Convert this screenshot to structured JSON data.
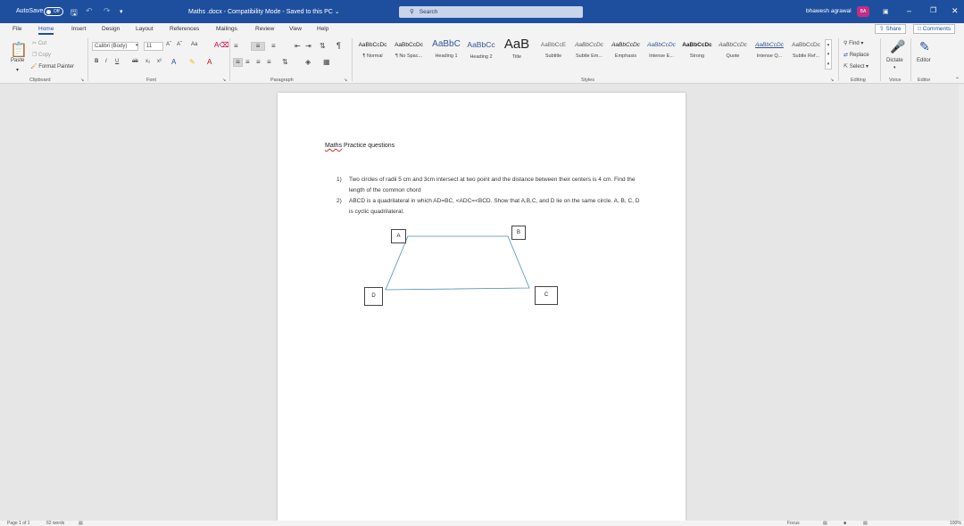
{
  "titlebar": {
    "autosave_label": "AutoSave",
    "autosave_state": "Off",
    "doc_title": "Maths .docx  -  Compatibility Mode  -  Saved to this PC  ⌄",
    "search_placeholder": "Search",
    "user_name": "bhawesh agrawal",
    "user_initials": "BA"
  },
  "menu": {
    "tabs": [
      "File",
      "Home",
      "Insert",
      "Design",
      "Layout",
      "References",
      "Mailings",
      "Review",
      "View",
      "Help"
    ],
    "share": "Share",
    "comments": "Comments"
  },
  "ribbon": {
    "clipboard": {
      "cut": "Cut",
      "copy": "Copy",
      "paste": "Paste",
      "format_painter": "Format Painter",
      "label": "Clipboard"
    },
    "font": {
      "name": "Calibri (Body)",
      "size": "11",
      "label": "Font",
      "case": "Aa"
    },
    "paragraph": {
      "label": "Paragraph"
    },
    "styles": {
      "label": "Styles",
      "items": [
        {
          "sample": "AaBbCcDc",
          "name": "¶ Normal"
        },
        {
          "sample": "AaBbCcDc",
          "name": "¶ No Spac..."
        },
        {
          "sample": "AaBbC",
          "name": "Heading 1"
        },
        {
          "sample": "AaBbCc",
          "name": "Heading 2"
        },
        {
          "sample": "AaB",
          "name": "Title"
        },
        {
          "sample": "AaBbCcE",
          "name": "Subtitle"
        },
        {
          "sample": "AaBbCcDc",
          "name": "Subtle Em..."
        },
        {
          "sample": "AaBbCcDc",
          "name": "Emphasis"
        },
        {
          "sample": "AaBbCcDc",
          "name": "Intense E..."
        },
        {
          "sample": "AaBbCcDc",
          "name": "Strong"
        },
        {
          "sample": "AaBbCcDc",
          "name": "Quote"
        },
        {
          "sample": "AaBbCcDc",
          "name": "Intense Q..."
        },
        {
          "sample": "AaBbCcDc",
          "name": "Subtle Ref..."
        }
      ]
    },
    "editing": {
      "find": "Find",
      "replace": "Replace",
      "select": "Select",
      "label": "Editing"
    },
    "voice": {
      "dictate": "Dictate",
      "label": "Voice"
    },
    "editor": {
      "editor": "Editor",
      "label": "Editor"
    }
  },
  "document": {
    "heading_underlined": "Maths",
    "heading_rest": " Practice questions",
    "questions": [
      {
        "num": "1)",
        "text": "Two circles of radii 5 cm and 3cm intersect at two point and the distance between their centers is 4 cm. Find the length of the common chord"
      },
      {
        "num": "2)",
        "text": "ABCD is a quadrilateral in which AD=BC, <ADC=<BCD. Show that A,B,C, and D lie on the same circle. A, B, C, D is cyclic quadrilateral."
      }
    ],
    "figure_labels": {
      "a": "A",
      "b": "B",
      "c": "C",
      "d": "D"
    }
  },
  "status": {
    "page": "Page 1 of 1",
    "words": "62 words",
    "focus": "Focus",
    "zoom": "100%"
  },
  "colors": {
    "word_blue": "#1e4f9e",
    "avatar": "#c12e86"
  }
}
